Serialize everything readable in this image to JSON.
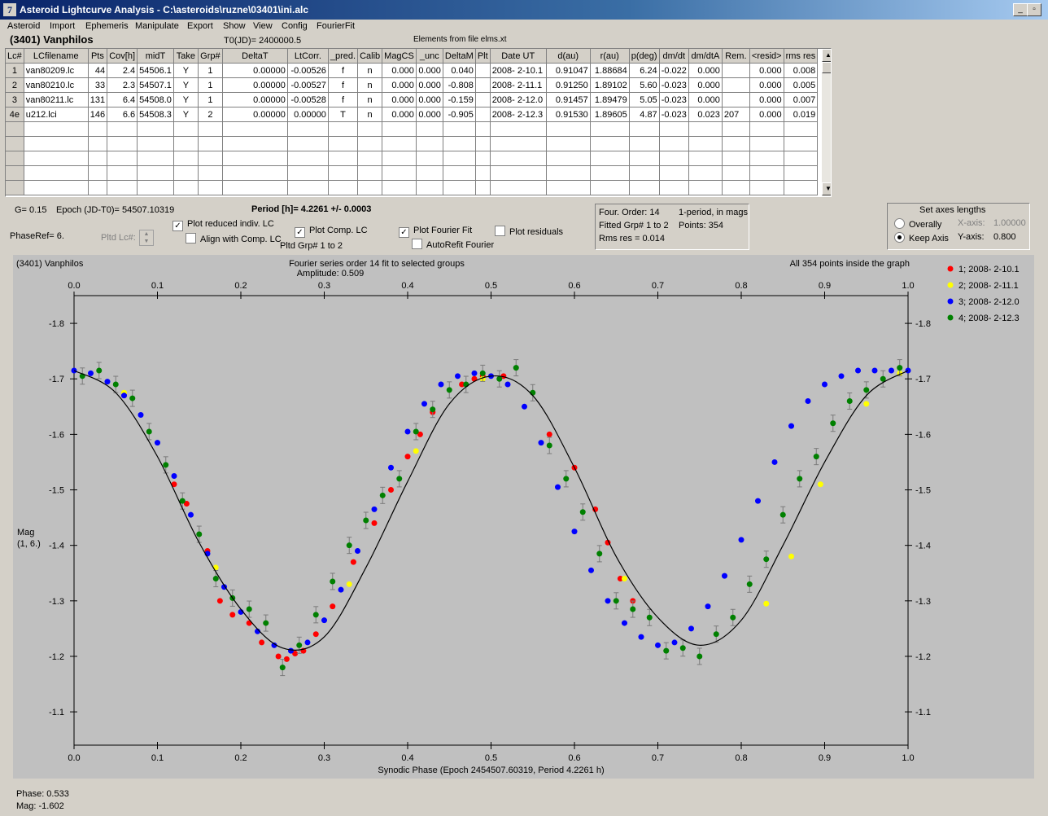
{
  "window": {
    "title": "Asteroid Lightcurve Analysis - C:\\asteroids\\ruzne\\03401\\ini.alc",
    "controls": [
      "_",
      "▫",
      "X"
    ]
  },
  "menu": [
    "Asteroid",
    "Import",
    "Ephemeris",
    "Manipulate",
    "Export",
    "Show",
    "View",
    "Config",
    "FourierFit"
  ],
  "header": {
    "asteroid": "(3401) Vanphilos",
    "t0": "T0(JD)= 2400000.5",
    "elements": "Elements from file elms.xt"
  },
  "table": {
    "columns": [
      "Lc#",
      "LCfilename",
      "Pts",
      "Cov[h]",
      "midT",
      "Take",
      "Grp#",
      "DeltaT",
      "LtCorr.",
      "_pred.",
      "Calib",
      "MagCS",
      "_unc",
      "DeltaM",
      "Plt",
      "Date UT",
      "d(au)",
      "r(au)",
      "p(deg)",
      "dm/dt",
      "dm/dtA",
      "Rem.",
      "<resid>",
      "rms res"
    ],
    "rows": [
      [
        "1",
        "van80209.lc",
        "44",
        "2.4",
        "54506.1",
        "Y",
        "1",
        "0.00000",
        "-0.00526",
        "f",
        "n",
        "0.000",
        "0.000",
        "0.040",
        "",
        "2008- 2-10.1",
        "0.91047",
        "1.88684",
        "6.24",
        "-0.022",
        "0.000",
        "",
        "0.000",
        "0.008"
      ],
      [
        "2",
        "van80210.lc",
        "33",
        "2.3",
        "54507.1",
        "Y",
        "1",
        "0.00000",
        "-0.00527",
        "f",
        "n",
        "0.000",
        "0.000",
        "-0.808",
        "",
        "2008- 2-11.1",
        "0.91250",
        "1.89102",
        "5.60",
        "-0.023",
        "0.000",
        "",
        "0.000",
        "0.005"
      ],
      [
        "3",
        "van80211.lc",
        "131",
        "6.4",
        "54508.0",
        "Y",
        "1",
        "0.00000",
        "-0.00528",
        "f",
        "n",
        "0.000",
        "0.000",
        "-0.159",
        "",
        "2008- 2-12.0",
        "0.91457",
        "1.89479",
        "5.05",
        "-0.023",
        "0.000",
        "",
        "0.000",
        "0.007"
      ],
      [
        "4e",
        "u212.lci",
        "146",
        "6.6",
        "54508.3",
        "Y",
        "2",
        "0.00000",
        "0.00000",
        "T",
        "n",
        "0.000",
        "0.000",
        "-0.905",
        "",
        "2008- 2-12.3",
        "0.91530",
        "1.89605",
        "4.87",
        "-0.023",
        "0.023",
        "207",
        "0.000",
        "0.019"
      ]
    ]
  },
  "controls": {
    "g": "G= 0.15",
    "epoch": "Epoch (JD-T0)= 54507.10319",
    "period": "Period [h]= 4.2261 +/- 0.0003",
    "phase_ref": "PhaseRef= 6.",
    "pltd_lc": "Pltd Lc#:",
    "plot_reduced": "Plot reduced indiv. LC",
    "align_comp": "Align with Comp. LC",
    "plot_comp": "Plot Comp. LC",
    "pltd_grp": "Pltd Grp#  1  to  2",
    "plot_fourier": "Plot Fourier Fit",
    "autorefit": "AutoRefit Fourier",
    "plot_residuals": "Plot residuals"
  },
  "fourier_box": {
    "order": "Four. Order: 14",
    "mode": "1-period, in mags",
    "fitted": "Fitted Grp# 1 to 2",
    "points": "Points: 354",
    "rms": "Rms res     = 0.014"
  },
  "axes_box": {
    "title": "Set axes lengths",
    "overally": "Overally",
    "keep_axis": "Keep Axis",
    "xaxis_label": "X-axis:",
    "xaxis_value": "1.00000",
    "yaxis_label": "Y-axis:",
    "yaxis_value": "0.800"
  },
  "colors": {
    "g1": "#ff0000",
    "g2": "#ffff00",
    "g3": "#0000ff",
    "g4": "#008000",
    "plot_bg": "#c0c0c0"
  },
  "chart_data": {
    "type": "scatter",
    "title": "Fourier series order 14 fit to selected groups",
    "subtitle": "Amplitude: 0.509",
    "corner_left": "(3401) Vanphilos",
    "corner_right": "All 354 points inside the graph",
    "xlabel": "Synodic Phase (Epoch 2454507.60319, Period 4.2261 h)",
    "ylabel": "Mag\n(1, 6.)",
    "xlim": [
      0,
      1
    ],
    "ylim": [
      -1.85,
      -1.04
    ],
    "y_inverted": true,
    "xticks": [
      0.0,
      0.1,
      0.2,
      0.3,
      0.4,
      0.5,
      0.6,
      0.7,
      0.8,
      0.9,
      1.0
    ],
    "yticks": [
      -1.8,
      -1.7,
      -1.6,
      -1.5,
      -1.4,
      -1.3,
      -1.2,
      -1.1
    ],
    "grid": false,
    "legend_position": "right",
    "fit_curve": {
      "phase": [
        0.0,
        0.05,
        0.1,
        0.15,
        0.2,
        0.25,
        0.3,
        0.35,
        0.4,
        0.45,
        0.5,
        0.55,
        0.6,
        0.65,
        0.7,
        0.75,
        0.8,
        0.85,
        0.9,
        0.95,
        1.0
      ],
      "mag": [
        -1.715,
        -1.675,
        -1.56,
        -1.405,
        -1.285,
        -1.215,
        -1.235,
        -1.36,
        -1.515,
        -1.655,
        -1.705,
        -1.67,
        -1.54,
        -1.38,
        -1.27,
        -1.22,
        -1.265,
        -1.4,
        -1.55,
        -1.67,
        -1.715
      ]
    },
    "series": [
      {
        "name": "1; 2008- 2-10.1",
        "color": "#ff0000",
        "x": [
          0.06,
          0.12,
          0.135,
          0.16,
          0.175,
          0.19,
          0.21,
          0.225,
          0.245,
          0.255,
          0.265,
          0.275,
          0.29,
          0.31,
          0.335,
          0.36,
          0.38,
          0.4,
          0.415,
          0.43,
          0.465,
          0.48,
          0.49,
          0.515,
          0.57,
          0.6,
          0.625,
          0.64,
          0.655,
          0.67
        ],
        "y": [
          -1.67,
          -1.51,
          -1.475,
          -1.39,
          -1.3,
          -1.275,
          -1.26,
          -1.225,
          -1.2,
          -1.195,
          -1.205,
          -1.21,
          -1.24,
          -1.29,
          -1.37,
          -1.44,
          -1.5,
          -1.56,
          -1.6,
          -1.64,
          -1.69,
          -1.7,
          -1.705,
          -1.705,
          -1.6,
          -1.54,
          -1.465,
          -1.405,
          -1.34,
          -1.3
        ]
      },
      {
        "name": "2; 2008- 2-11.1",
        "color": "#ffff00",
        "x": [
          0.06,
          0.17,
          0.33,
          0.41,
          0.49,
          0.66,
          0.83,
          0.86,
          0.895,
          0.95,
          0.99
        ],
        "y": [
          -1.675,
          -1.36,
          -1.33,
          -1.57,
          -1.7,
          -1.34,
          -1.295,
          -1.38,
          -1.51,
          -1.655,
          -1.71
        ]
      },
      {
        "name": "3; 2008- 2-12.0",
        "color": "#0000ff",
        "x": [
          0.0,
          0.02,
          0.04,
          0.06,
          0.08,
          0.1,
          0.12,
          0.14,
          0.16,
          0.18,
          0.2,
          0.22,
          0.24,
          0.26,
          0.28,
          0.3,
          0.32,
          0.34,
          0.36,
          0.38,
          0.4,
          0.42,
          0.44,
          0.46,
          0.48,
          0.5,
          0.52,
          0.54,
          0.56,
          0.58,
          0.6,
          0.62,
          0.64,
          0.66,
          0.68,
          0.7,
          0.72,
          0.74,
          0.76,
          0.78,
          0.8,
          0.82,
          0.84,
          0.86,
          0.88,
          0.9,
          0.92,
          0.94,
          0.96,
          0.98,
          1.0
        ],
        "y": [
          -1.715,
          -1.71,
          -1.695,
          -1.67,
          -1.635,
          -1.585,
          -1.525,
          -1.455,
          -1.385,
          -1.325,
          -1.28,
          -1.245,
          -1.22,
          -1.21,
          -1.225,
          -1.265,
          -1.32,
          -1.39,
          -1.465,
          -1.54,
          -1.605,
          -1.655,
          -1.69,
          -1.705,
          -1.71,
          -1.705,
          -1.69,
          -1.65,
          -1.585,
          -1.505,
          -1.425,
          -1.355,
          -1.3,
          -1.26,
          -1.235,
          -1.22,
          -1.225,
          -1.25,
          -1.29,
          -1.345,
          -1.41,
          -1.48,
          -1.55,
          -1.615,
          -1.66,
          -1.69,
          -1.705,
          -1.715,
          -1.715,
          -1.715,
          -1.715
        ]
      },
      {
        "name": "4; 2008- 2-12.3",
        "color": "#008000",
        "x": [
          0.01,
          0.03,
          0.05,
          0.07,
          0.09,
          0.11,
          0.13,
          0.15,
          0.17,
          0.19,
          0.21,
          0.23,
          0.25,
          0.27,
          0.29,
          0.31,
          0.33,
          0.35,
          0.37,
          0.39,
          0.41,
          0.43,
          0.45,
          0.47,
          0.49,
          0.51,
          0.53,
          0.55,
          0.57,
          0.59,
          0.61,
          0.63,
          0.65,
          0.67,
          0.69,
          0.71,
          0.73,
          0.75,
          0.77,
          0.79,
          0.81,
          0.83,
          0.85,
          0.87,
          0.89,
          0.91,
          0.93,
          0.95,
          0.97,
          0.99
        ],
        "y": [
          -1.705,
          -1.715,
          -1.69,
          -1.665,
          -1.605,
          -1.545,
          -1.48,
          -1.42,
          -1.34,
          -1.305,
          -1.285,
          -1.26,
          -1.18,
          -1.22,
          -1.275,
          -1.335,
          -1.4,
          -1.445,
          -1.49,
          -1.52,
          -1.605,
          -1.645,
          -1.68,
          -1.69,
          -1.71,
          -1.7,
          -1.72,
          -1.675,
          -1.58,
          -1.52,
          -1.46,
          -1.385,
          -1.3,
          -1.285,
          -1.27,
          -1.21,
          -1.215,
          -1.2,
          -1.24,
          -1.27,
          -1.33,
          -1.375,
          -1.455,
          -1.52,
          -1.56,
          -1.62,
          -1.66,
          -1.68,
          -1.7,
          -1.72
        ]
      }
    ]
  },
  "status": {
    "phase": "Phase:  0.533",
    "mag": "Mag:   -1.602"
  }
}
